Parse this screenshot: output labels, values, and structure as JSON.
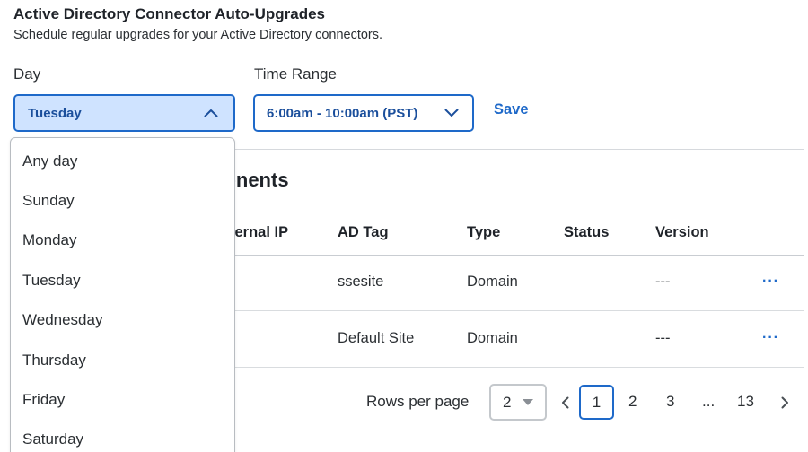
{
  "header": {
    "title": "Active Directory Connector Auto-Upgrades",
    "subtitle": "Schedule regular upgrades for your Active Directory connectors."
  },
  "form": {
    "day_label": "Day",
    "day_value": "Tuesday",
    "time_label": "Time Range",
    "time_value": "6:00am - 10:00am (PST)",
    "save_label": "Save"
  },
  "dropdown": {
    "options": [
      "Any day",
      "Sunday",
      "Monday",
      "Tuesday",
      "Wednesday",
      "Thursday",
      "Friday",
      "Saturday"
    ]
  },
  "section": {
    "heading_visible": "ponents"
  },
  "table": {
    "columns": [
      "ternal IP",
      "AD Tag",
      "Type",
      "Status",
      "Version"
    ],
    "rows": [
      {
        "ad_tag": "ssesite",
        "type": "Domain",
        "status": "",
        "version": "---",
        "actions": "···"
      },
      {
        "ad_tag": "Default Site",
        "type": "Domain",
        "status": "",
        "version": "---",
        "actions": "···"
      }
    ]
  },
  "pagination": {
    "rows_per_page_label": "Rows per page",
    "rows_per_page_value": "2",
    "pages": [
      "1",
      "2",
      "3",
      "...",
      "13"
    ],
    "current_page": "1"
  },
  "colors": {
    "accent": "#1e69c9",
    "selected_bg": "#cfe3ff",
    "text": "#1f2329"
  },
  "icons": {
    "day_select": "chevron-up-icon",
    "time_select": "chevron-down-icon",
    "rows_select": "caret-down-icon",
    "prev": "chevron-left-icon",
    "next": "chevron-right-icon"
  }
}
